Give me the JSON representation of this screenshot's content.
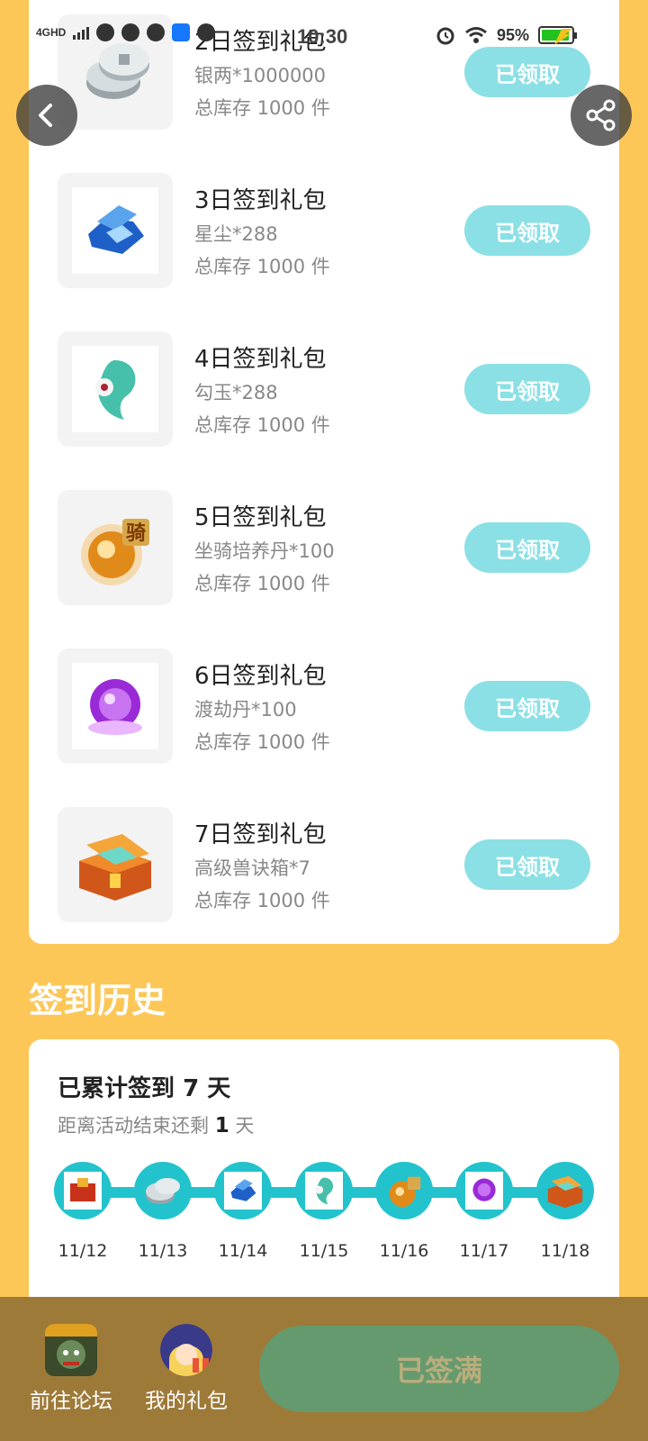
{
  "status_bar": {
    "network": "4GHD",
    "time": "10:30",
    "battery": "95%",
    "battery_level": 0.95
  },
  "gifts": [
    {
      "title": "2日签到礼包",
      "desc": "银两*1000000",
      "stock": "总库存 1000 件",
      "button": "已领取",
      "icon": "silver-coin-icon"
    },
    {
      "title": "3日签到礼包",
      "desc": "星尘*288",
      "stock": "总库存 1000 件",
      "button": "已领取",
      "icon": "blue-crystal-chest-icon"
    },
    {
      "title": "4日签到礼包",
      "desc": "勾玉*288",
      "stock": "总库存 1000 件",
      "button": "已领取",
      "icon": "magatama-jade-icon"
    },
    {
      "title": "5日签到礼包",
      "desc": "坐骑培养丹*100",
      "stock": "总库存 1000 件",
      "button": "已领取",
      "icon": "mount-pill-icon",
      "badge": "骑"
    },
    {
      "title": "6日签到礼包",
      "desc": "渡劫丹*100",
      "stock": "总库存 1000 件",
      "button": "已领取",
      "icon": "purple-orb-icon"
    },
    {
      "title": "7日签到礼包",
      "desc": "高级兽诀箱*7",
      "stock": "总库存 1000 件",
      "button": "已领取",
      "icon": "treasure-chest-icon"
    }
  ],
  "history": {
    "title": "签到历史",
    "total_prefix": "已累计签到 ",
    "total_days": "7",
    "total_suffix": " 天",
    "remain_prefix": "距离活动结束还剩 ",
    "remain_days": "1",
    "remain_suffix": " 天",
    "dates": [
      "11/12",
      "11/13",
      "11/14",
      "11/15",
      "11/16",
      "11/17",
      "11/18"
    ]
  },
  "bottom_bar": {
    "forum_label": "前往论坛",
    "gifts_label": "我的礼包",
    "full_button": "已签满"
  },
  "colors": {
    "page_bg": "#fdc758",
    "claimed_button": "#8be0e5",
    "timeline": "#22c3cc",
    "bottom_bar": "#9e7a39",
    "full_button": "#659a6e"
  }
}
